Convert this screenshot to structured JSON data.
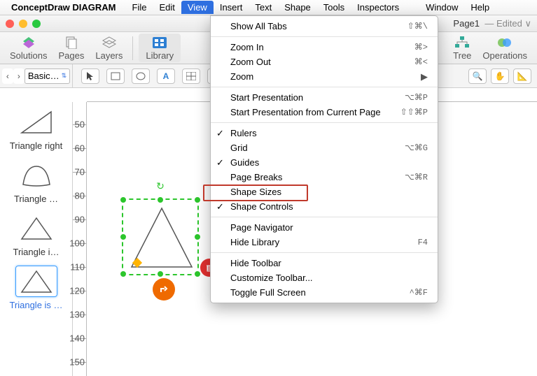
{
  "menubar": {
    "app": "ConceptDraw DIAGRAM",
    "items": [
      "File",
      "Edit",
      "View",
      "Insert",
      "Text",
      "Shape",
      "Tools",
      "Inspectors",
      "Window",
      "Help"
    ],
    "active_index": 2
  },
  "titlebar": {
    "page_label": "Page1",
    "state": "Edited"
  },
  "toolbar": {
    "solutions": "Solutions",
    "pages": "Pages",
    "layers": "Layers",
    "library": "Library",
    "tree": "Tree",
    "operations": "Operations"
  },
  "secbar": {
    "nav_label": "Basic…"
  },
  "ruler_v": [
    50,
    60,
    70,
    80,
    90,
    100,
    110,
    120,
    130,
    140,
    150
  ],
  "library": [
    {
      "label": "Triangle right"
    },
    {
      "label": "Triangle …"
    },
    {
      "label": "Triangle i…"
    },
    {
      "label": "Triangle is …"
    }
  ],
  "selected_lib_index": 3,
  "view_menu": {
    "groups": [
      [
        {
          "label": "Show All Tabs",
          "hotkey": "⇧⌘\\"
        }
      ],
      [
        {
          "label": "Zoom In",
          "hotkey": "⌘>"
        },
        {
          "label": "Zoom Out",
          "hotkey": "⌘<"
        },
        {
          "label": "Zoom",
          "submenu": true
        }
      ],
      [
        {
          "label": "Start Presentation",
          "hotkey": "⌥⌘P"
        },
        {
          "label": "Start Presentation from Current Page",
          "hotkey": "⇧⇧⌘P"
        }
      ],
      [
        {
          "label": "Rulers",
          "checked": true
        },
        {
          "label": "Grid",
          "hotkey": "⌥⌘G"
        },
        {
          "label": "Guides",
          "checked": true
        },
        {
          "label": "Page Breaks",
          "hotkey": "⌥⌘R"
        },
        {
          "label": "Shape Sizes"
        },
        {
          "label": "Shape Controls",
          "checked": true,
          "boxed": true
        }
      ],
      [
        {
          "label": "Page Navigator"
        },
        {
          "label": "Hide Library",
          "hotkey": "F4"
        }
      ],
      [
        {
          "label": "Hide Toolbar"
        },
        {
          "label": "Customize Toolbar..."
        },
        {
          "label": "Toggle Full Screen",
          "hotkey": "^⌘F"
        }
      ]
    ]
  }
}
